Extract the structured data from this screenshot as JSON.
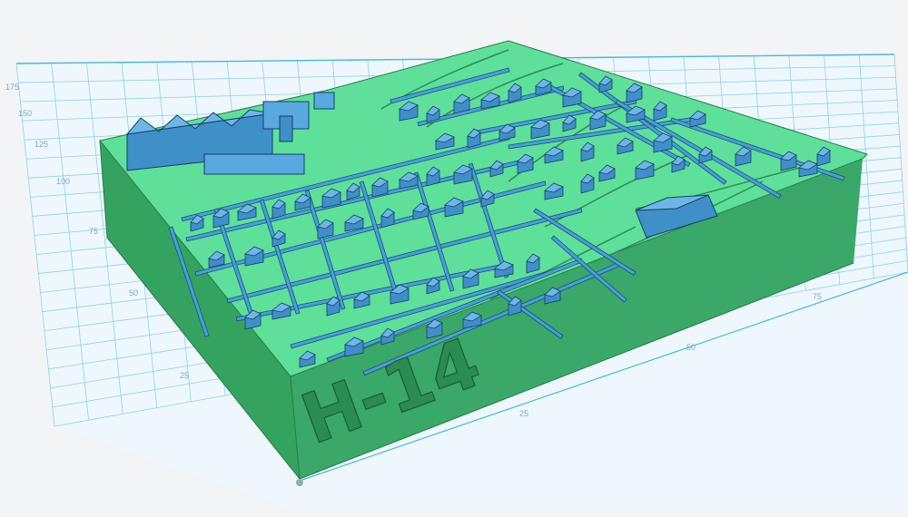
{
  "viewport": {
    "workplane_grid_color": "#47b8e6",
    "model_top_color": "#5ee09a",
    "model_side_color": "#3aa868",
    "building_color": "#4a9fd8",
    "background_color": "#f3f4f6"
  },
  "axis_left_ticks": [
    "175",
    "150",
    "125",
    "100",
    "75",
    "50",
    "25"
  ],
  "axis_front_ticks": [
    "25",
    "50",
    "75"
  ],
  "model": {
    "embossed_label": "H-14",
    "icon": "3d-city-terrain-model"
  }
}
